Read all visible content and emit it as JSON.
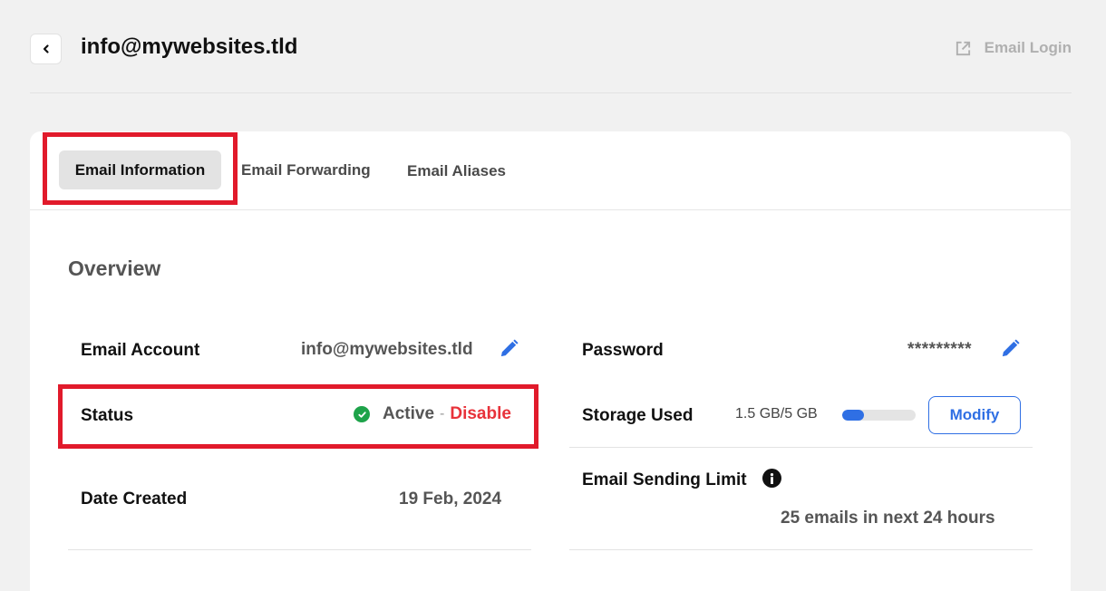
{
  "header": {
    "title": "info@mywebsites.tld",
    "email_login_label": "Email Login"
  },
  "tabs": [
    {
      "label": "Email Information",
      "active": true
    },
    {
      "label": "Email Forwarding",
      "active": false
    },
    {
      "label": "Email Aliases",
      "active": false
    }
  ],
  "overview": {
    "heading": "Overview",
    "email_account_label": "Email Account",
    "email_account_value": "info@mywebsites.tld",
    "status_label": "Status",
    "status_value": "Active",
    "status_separator": "-",
    "disable_label": "Disable",
    "date_created_label": "Date Created",
    "date_created_value": "19 Feb, 2024",
    "password_label": "Password",
    "password_value": "*********",
    "storage_label": "Storage Used",
    "storage_value": "1.5 GB/5 GB",
    "storage_fraction": 0.3,
    "modify_label": "Modify",
    "sending_limit_label": "Email Sending Limit",
    "sending_limit_value": "25 emails in next 24 hours"
  },
  "colors": {
    "accent": "#2f6fe4",
    "danger": "#e8323a",
    "success": "#1ea34a",
    "highlight": "#e11a2b"
  },
  "icons": [
    "chevron-left-icon",
    "external-link-icon",
    "pencil-icon",
    "check-circle-icon",
    "info-icon"
  ]
}
